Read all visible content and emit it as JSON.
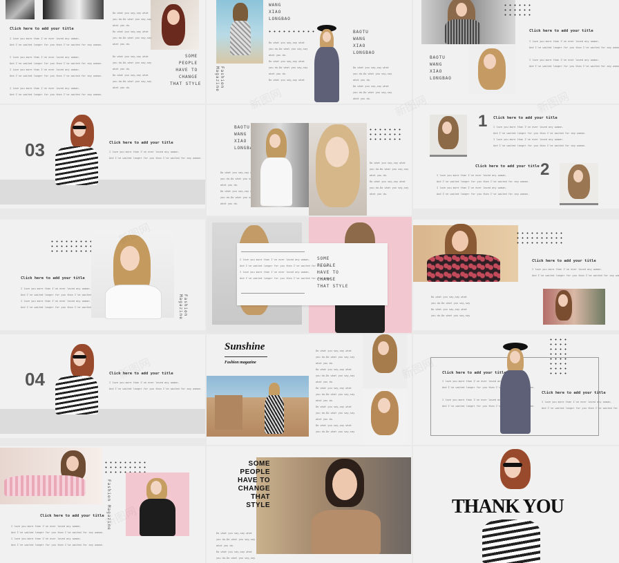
{
  "common": {
    "title": "Click here to add your title",
    "body_lines": [
      "I love you more than I've ever loved any woman.",
      "And I've waited longer for you than I've waited for any woman."
    ],
    "short_lines": [
      "Do what you say,say what",
      "you do.Do what you say,say",
      "what you do."
    ],
    "names": [
      "BAOTU",
      "WANG",
      "XIAO",
      "LONGBAO"
    ],
    "slogan": [
      "SOME",
      "PEOPLE",
      "HAVE TO",
      "CHANGE",
      "THAT STYLE"
    ],
    "magazine": "Fashion Magazine"
  },
  "slides": {
    "s03": {
      "number": "03"
    },
    "s04": {
      "number": "04"
    },
    "list_1": {
      "number": "1"
    },
    "list_2": {
      "number": "2"
    },
    "sunshine": {
      "title": "Sunshine",
      "subtitle": "Fashion magazine"
    },
    "slogan_bold": [
      "SOME",
      "PEOPLE",
      "HAVE TO",
      "CHANGE",
      "THAT",
      "STYLE"
    ],
    "end": {
      "text": "THANK YOU"
    }
  },
  "watermark": "新图网",
  "colors": {
    "slide_bg": "#f1f1f1",
    "page_bg": "#e9e9e9",
    "pink": "#f3c7cf",
    "gray_bar": "#dcdcdc",
    "number_gray": "#555555"
  }
}
